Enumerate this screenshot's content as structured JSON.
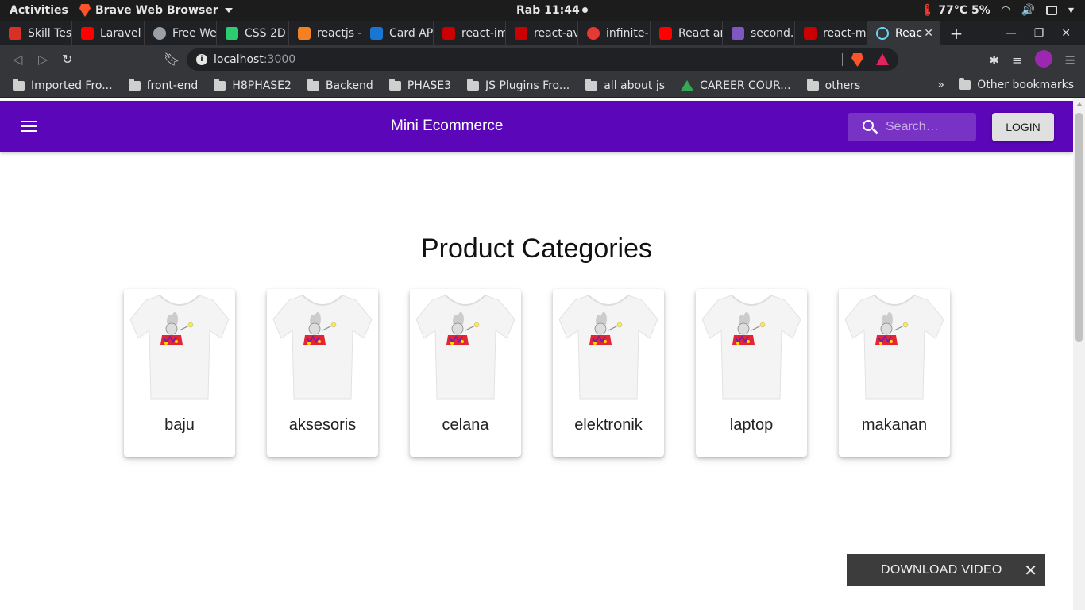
{
  "system": {
    "activities": "Activities",
    "app_name": "Brave Web Browser",
    "clock": "Rab 11:44",
    "temperature": "77°C 5%"
  },
  "tabs": [
    {
      "label": "Skill Tes",
      "color": "#d93025"
    },
    {
      "label": "Laravel",
      "color": "#ff0000"
    },
    {
      "label": "Free We",
      "color": "#9aa0a6"
    },
    {
      "label": "CSS 2D",
      "color": "#2ecc71"
    },
    {
      "label": "reactjs -",
      "color": "#f48024"
    },
    {
      "label": "Card AP",
      "color": "#1976d2"
    },
    {
      "label": "react-im",
      "color": "#cb0000"
    },
    {
      "label": "react-av",
      "color": "#cb0000"
    },
    {
      "label": "infinite-",
      "color": "#e53935"
    },
    {
      "label": "React ar",
      "color": "#ff0000"
    },
    {
      "label": "second.",
      "color": "#7e57c2"
    },
    {
      "label": "react-m",
      "color": "#cb0000"
    },
    {
      "label": "Reac",
      "color": "#61dafb",
      "active": true
    }
  ],
  "address": {
    "host": "localhost",
    "port": ":3000"
  },
  "bookmarks": [
    {
      "label": "Imported Fro...",
      "icon": "folder-icon"
    },
    {
      "label": "front-end",
      "icon": "folder-icon"
    },
    {
      "label": "H8PHASE2",
      "icon": "folder-icon"
    },
    {
      "label": "Backend",
      "icon": "folder-icon"
    },
    {
      "label": "PHASE3",
      "icon": "folder-icon"
    },
    {
      "label": "JS Plugins Fro...",
      "icon": "folder-icon"
    },
    {
      "label": "all about js",
      "icon": "folder-icon"
    },
    {
      "label": "CAREER COUR...",
      "icon": "drive-icon"
    },
    {
      "label": "others",
      "icon": "folder-icon"
    }
  ],
  "bookmarks_more": "»",
  "other_bookmarks": "Other bookmarks",
  "app": {
    "brand": "Mini Ecommerce",
    "search_placeholder": "Search…",
    "login_label": "LOGIN",
    "accent": "#5b07b9"
  },
  "page": {
    "heading": "Product Categories",
    "categories": [
      "baju",
      "aksesoris",
      "celana",
      "elektronik",
      "laptop",
      "makanan"
    ]
  },
  "download_bar": {
    "label": "DOWNLOAD VIDEO",
    "close": "✕"
  }
}
